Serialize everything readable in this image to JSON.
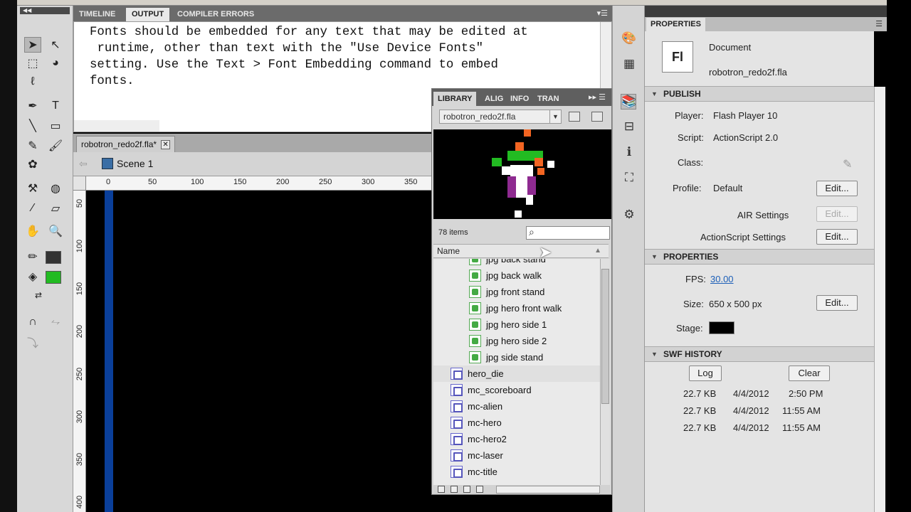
{
  "output_panel": {
    "tabs": [
      "TIMELINE",
      "OUTPUT",
      "COMPILER ERRORS"
    ],
    "active_tab": "OUTPUT",
    "message": "Fonts should be embedded for any text that may be edited at\n runtime, other than text with the \"Use Device Fonts\"\nsetting. Use the Text > Font Embedding command to embed\nfonts."
  },
  "document": {
    "tab_label": "robotron_redo2f.fla*",
    "close_glyph": "✕",
    "scene_label": "Scene 1",
    "ruler_x": [
      "0",
      "50",
      "100",
      "150",
      "200",
      "250",
      "300",
      "350"
    ],
    "ruler_y": [
      "50",
      "100",
      "150",
      "200",
      "250",
      "300",
      "350",
      "400"
    ]
  },
  "library": {
    "tabs": [
      "LIBRARY",
      "ALIG",
      "INFO",
      "TRAN"
    ],
    "file": "robotron_redo2f.fla",
    "item_count": "78 items",
    "column_name": "Name",
    "items": [
      {
        "label": "jpg back stand",
        "kind": "bitmap",
        "indent": true
      },
      {
        "label": "jpg back walk",
        "kind": "bitmap",
        "indent": true
      },
      {
        "label": "jpg front stand",
        "kind": "bitmap",
        "indent": true
      },
      {
        "label": "jpg hero front walk",
        "kind": "bitmap",
        "indent": true
      },
      {
        "label": "jpg hero side 1",
        "kind": "bitmap",
        "indent": true
      },
      {
        "label": "jpg hero side 2",
        "kind": "bitmap",
        "indent": true
      },
      {
        "label": "jpg side stand",
        "kind": "bitmap",
        "indent": true
      },
      {
        "label": "hero_die",
        "kind": "movieclip",
        "indent": false
      },
      {
        "label": "mc_scoreboard",
        "kind": "movieclip",
        "indent": false
      },
      {
        "label": "mc-alien",
        "kind": "movieclip",
        "indent": false
      },
      {
        "label": "mc-hero",
        "kind": "movieclip",
        "indent": false
      },
      {
        "label": "mc-hero2",
        "kind": "movieclip",
        "indent": false
      },
      {
        "label": "mc-laser",
        "kind": "movieclip",
        "indent": false
      },
      {
        "label": "mc-title",
        "kind": "movieclip",
        "indent": false
      }
    ]
  },
  "properties": {
    "tab": "PROPERTIES",
    "logo": "Fl",
    "doc_type": "Document",
    "doc_name": "robotron_redo2f.fla",
    "publish": {
      "header": "PUBLISH",
      "player_label": "Player:",
      "player_value": "Flash Player 10",
      "script_label": "Script:",
      "script_value": "ActionScript 2.0",
      "class_label": "Class:",
      "profile_label": "Profile:",
      "profile_value": "Default",
      "edit_label": "Edit...",
      "air_label": "AIR Settings",
      "as_label": "ActionScript Settings"
    },
    "props_section": {
      "header": "PROPERTIES",
      "fps_label": "FPS:",
      "fps_value": "30.00",
      "size_label": "Size:",
      "size_value": "650 x 500 px",
      "stage_label": "Stage:",
      "stage_color": "#000000"
    },
    "swf_history": {
      "header": "SWF HISTORY",
      "log_button": "Log",
      "clear_button": "Clear",
      "entries": [
        {
          "size": "22.7 KB",
          "date": "4/4/2012",
          "time": "2:50 PM"
        },
        {
          "size": "22.7 KB",
          "date": "4/4/2012",
          "time": "11:55 AM"
        },
        {
          "size": "22.7 KB",
          "date": "4/4/2012",
          "time": "11:55 AM"
        }
      ]
    }
  },
  "colors": {
    "panel_bg": "#e4e4e4",
    "tab_dark": "#6b6b6b",
    "stage_blue": "#0a3f9a",
    "link_blue": "#1c5fb8"
  }
}
